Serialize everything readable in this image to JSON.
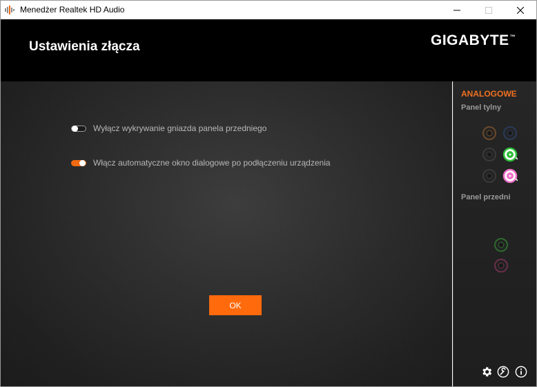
{
  "window": {
    "title": "Menedżer Realtek HD Audio"
  },
  "header": {
    "title": "Ustawienia złącza",
    "brand": "GIGABYTE",
    "brand_mark": "™"
  },
  "options": [
    {
      "label": "Wyłącz wykrywanie gniazda panela przedniego",
      "enabled": false
    },
    {
      "label": "Włącz automatyczne okno dialogowe po podłączeniu urządzenia",
      "enabled": true
    }
  ],
  "ok_label": "OK",
  "side_panel": {
    "section": "ANALOGOWE",
    "rear_label": "Panel tylny",
    "front_label": "Panel przedni",
    "rear_jacks": [
      {
        "color": "#6b4a2a",
        "active": false
      },
      {
        "color": "#2a3a5a",
        "active": false
      },
      {
        "color": "#3a3a3a",
        "active": false
      },
      {
        "color": "#2fbf3a",
        "active": true
      },
      {
        "color": "#3a3a3a",
        "active": false
      },
      {
        "color": "#f06fc8",
        "active": true
      }
    ],
    "front_jacks": [
      {
        "color": "#2f6a2f",
        "active": false
      },
      {
        "color": "#6a2f4a",
        "active": false
      }
    ]
  },
  "colors": {
    "accent": "#ff6a0d",
    "section_title": "#f07020"
  },
  "icons": {
    "bottom": [
      "gear-icon",
      "wrench-icon",
      "info-icon"
    ]
  }
}
